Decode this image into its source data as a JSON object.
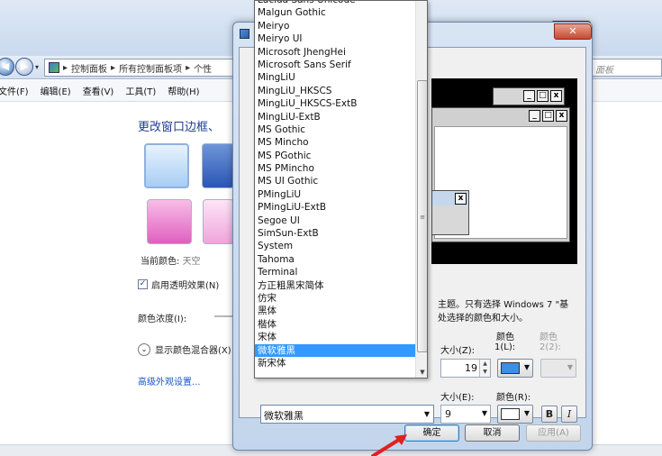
{
  "explorer": {
    "close_glyph": "✕",
    "nav_back_glyph": "◀",
    "nav_forward_glyph": "▶",
    "nav_dropdown_glyph": "▾",
    "breadcrumb_1": "控制面板",
    "breadcrumb_sep": "▸",
    "breadcrumb_2": "所有控制面板项",
    "breadcrumb_3": "个性",
    "search_placeholder": "面板",
    "menus": [
      "文件(F)",
      "编辑(E)",
      "查看(V)",
      "工具(T)",
      "帮助(H)"
    ],
    "page_title": "更改窗口边框、",
    "current_color_label": "当前颜色: ",
    "current_color_value": "天空",
    "transparency_label": "启用透明效果(N)",
    "transparency_checked": "✓",
    "intensity_label": "颜色浓度(I):",
    "mixer_toggle_glyph": "⌄",
    "mixer_label": "显示颜色混合器(X)",
    "advanced_link": "高级外观设置..."
  },
  "dialog": {
    "close_glyph": "✕",
    "preview_btn_min": "_",
    "preview_btn_max": "□",
    "preview_btn_close": "x",
    "description_line1": "主题。只有选择 Windows 7 \"基",
    "description_line2": "处选择的颜色和大小。",
    "size_label": "大小(Z):",
    "color1_head": "颜色",
    "color1_sub": "1(L):",
    "color2_head": "颜色",
    "color2_sub": "2(2):",
    "size_value": "19",
    "spin_up": "▲",
    "spin_down": "▼",
    "dropdown_glyph": "▼",
    "font_size_label": "大小(E):",
    "font_color_label": "颜色(R):",
    "font_size_value": "9",
    "bold_label": "B",
    "italic_label": "I",
    "font_value": "微软雅黑",
    "ok_label": "确定",
    "cancel_label": "取消",
    "apply_label": "应用(A)",
    "color1_value": "#3a8fe8",
    "font_color_value": "#ffffff"
  },
  "font_list": {
    "items": [
      "Lucida Sans Unicode",
      "Malgun Gothic",
      "Meiryo",
      "Meiryo UI",
      "Microsoft JhengHei",
      "Microsoft Sans Serif",
      "MingLiU",
      "MingLiU_HKSCS",
      "MingLiU_HKSCS-ExtB",
      "MingLiU-ExtB",
      "MS Gothic",
      "MS Mincho",
      "MS PGothic",
      "MS PMincho",
      "MS UI Gothic",
      "PMingLiU",
      "PMingLiU-ExtB",
      "Segoe UI",
      "SimSun-ExtB",
      "System",
      "Tahoma",
      "Terminal",
      "方正粗黑宋简体",
      "仿宋",
      "黑体",
      "楷体",
      "宋体",
      "微软雅黑",
      "新宋体"
    ],
    "selected": "微软雅黑",
    "thumb_grip": "≡",
    "scroll_down": "▼"
  },
  "colors": {
    "accent": "#3399ff",
    "close_button": "#c64a32",
    "pointer_arrow": "#e02020"
  }
}
